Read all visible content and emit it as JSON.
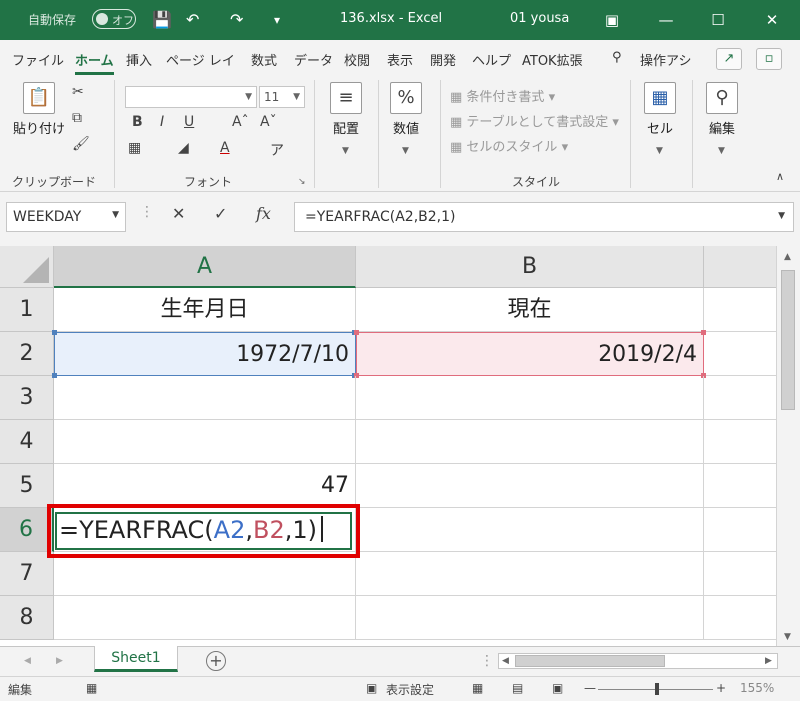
{
  "titlebar": {
    "autosave_label": "自動保存",
    "autosave_state": "オフ",
    "title": "136.xlsx - Excel",
    "user": "01 yousa"
  },
  "tabs": [
    "ファイル",
    "ホーム",
    "挿入",
    "ページ レイ",
    "数式",
    "データ",
    "校閲",
    "表示",
    "開発",
    "ヘルプ",
    "ATOK拡張",
    "操作アシ"
  ],
  "active_tab": "ホーム",
  "ribbon": {
    "clipboard": {
      "paste": "貼り付け",
      "label": "クリップボード"
    },
    "font": {
      "name": "",
      "size": "11",
      "label": "フォント",
      "bold": "B",
      "italic": "I",
      "underline": "U"
    },
    "alignment": {
      "label": "配置"
    },
    "number": {
      "label": "数値"
    },
    "styles": {
      "conditional": "条件付き書式",
      "table": "テーブルとして書式設定",
      "cell_style": "セルのスタイル",
      "label": "スタイル"
    },
    "cells": {
      "label": "セル"
    },
    "editing": {
      "label": "編集"
    }
  },
  "formula_bar": {
    "name_box": "WEEKDAY",
    "fx": "fx",
    "formula": "=YEARFRAC(A2,B2,1)"
  },
  "grid": {
    "columns": [
      "A",
      "B"
    ],
    "rows": [
      "1",
      "2",
      "3",
      "4",
      "5",
      "6",
      "7",
      "8"
    ],
    "cells": {
      "A1": "生年月日",
      "B1": "現在",
      "A2": "1972/7/10",
      "B2": "2019/2/4",
      "A5": "47"
    },
    "editing": {
      "prefix": "=YEARFRAC(",
      "ref1": "A2",
      "comma1": ",",
      "ref2": "B2",
      "suffix": ",1)"
    }
  },
  "sheets": {
    "active": "Sheet1"
  },
  "status": {
    "mode": "編集",
    "display_settings": "表示設定",
    "zoom": "155%"
  }
}
